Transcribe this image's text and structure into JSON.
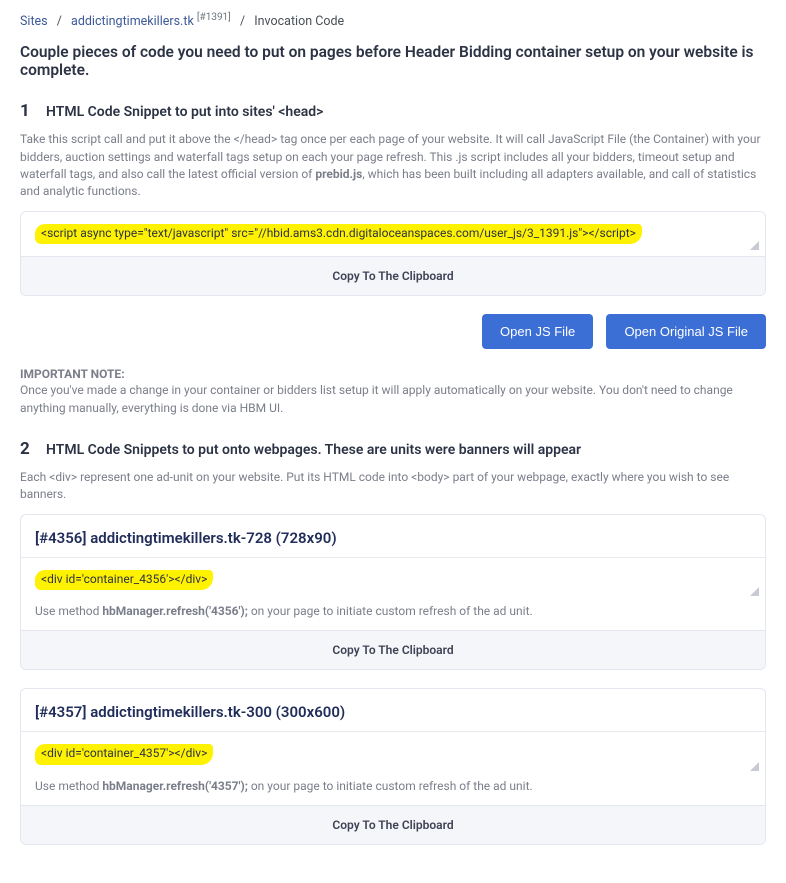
{
  "breadcrumb": {
    "sites": "Sites",
    "site_name": "addictingtimekillers.tk",
    "site_id_sup": "[#1391]",
    "current": "Invocation Code"
  },
  "page_title": "Couple pieces of code you need to put on pages before Header Bidding container setup on your website is complete.",
  "section1": {
    "num": "1",
    "title": "HTML Code Snippet to put into sites' <head>",
    "desc_a": "Take this script call and put it above the </head> tag once per each page of your website. It will call JavaScript File (the Container) with your bidders, auction settings and waterfall tags setup on each your page refresh. This .js script includes all your bidders, timeout setup and waterfall tags, and also call the latest official version of ",
    "desc_b": "prebid.js",
    "desc_c": ", which has been built including all adapters available, and call of statistics and analytic functions.",
    "code": "<script async type=\"text/javascript\" src=\"//hbid.ams3.cdn.digitaloceanspaces.com/user_js/3_1391.js\"></script>",
    "copy": "Copy To The Clipboard"
  },
  "buttons": {
    "open_js": "Open JS File",
    "open_orig": "Open Original JS File"
  },
  "note": {
    "head": "IMPORTANT NOTE",
    "body": "Once you've made a change in your container or bidders list setup it will apply automatically on your website. You don't need to change anything manually, everything is done via HBM UI."
  },
  "section2": {
    "num": "2",
    "title": "HTML Code Snippets to put onto webpages. These are units were banners will appear",
    "desc": "Each <div> represent one ad-unit on your website. Put its HTML code into <body> part of your webpage, exactly where you wish to see banners."
  },
  "units": [
    {
      "title": "[#4356] addictingtimekillers.tk-728 (728x90)",
      "code": "<div id='container_4356'></div>",
      "refresh_a": "Use method ",
      "refresh_b": "hbManager.refresh('4356');",
      "refresh_c": " on your page to initiate custom refresh of the ad unit.",
      "copy": "Copy To The Clipboard"
    },
    {
      "title": "[#4357] addictingtimekillers.tk-300 (300x600)",
      "code": "<div id='container_4357'></div>",
      "refresh_a": "Use method ",
      "refresh_b": "hbManager.refresh('4357');",
      "refresh_c": " on your page to initiate custom refresh of the ad unit.",
      "copy": "Copy To The Clipboard"
    }
  ]
}
